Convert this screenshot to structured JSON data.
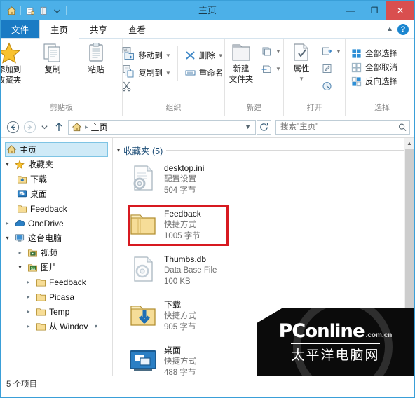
{
  "window": {
    "title": "主页",
    "quick_access": [
      "home-icon",
      "new-folder-icon",
      "properties-icon",
      "customize-dropdown"
    ],
    "minimize_label": "—",
    "maximize_label": "❐",
    "close_label": "✕"
  },
  "ribbon": {
    "tabs": [
      {
        "label": "文件",
        "type": "file"
      },
      {
        "label": "主页",
        "type": "active"
      },
      {
        "label": "共享",
        "type": "normal"
      },
      {
        "label": "查看",
        "type": "normal"
      }
    ],
    "collapse_icon": "chevron-up-icon",
    "help_label": "?",
    "groups": [
      {
        "name": "剪贴板",
        "big": [
          {
            "label": "添加到\n收藏夹",
            "label_line1": "添加到",
            "label_line2": "收藏夹",
            "icon": "star-icon"
          },
          {
            "label": "复制",
            "icon": "copy-icon"
          },
          {
            "label": "粘贴",
            "icon": "paste-icon"
          }
        ],
        "small": [
          {
            "label": "",
            "icon": "copy-path-icon"
          },
          {
            "label": "",
            "icon": "paste-shortcut-icon"
          },
          {
            "label": "",
            "icon": "cut-icon"
          }
        ]
      },
      {
        "name": "组织",
        "items": [
          {
            "label": "移动到",
            "icon": "move-to-icon",
            "dropdown": true
          },
          {
            "label": "复制到",
            "icon": "copy-to-icon",
            "dropdown": true
          },
          {
            "label": "删除",
            "icon": "delete-icon",
            "dropdown": true
          },
          {
            "label": "重命名",
            "icon": "rename-icon",
            "dropdown": false
          }
        ]
      },
      {
        "name": "新建",
        "big": [
          {
            "label_line1": "新建",
            "label_line2": "文件夹",
            "icon": "new-folder-icon"
          }
        ],
        "small": [
          {
            "label": "",
            "icon": "new-item-icon",
            "dropdown": true
          },
          {
            "label": "",
            "icon": "easy-access-icon",
            "dropdown": true
          }
        ]
      },
      {
        "name": "打开",
        "big": [
          {
            "label_line1": "属性",
            "label_line2": "",
            "icon": "properties-icon",
            "dropdown": true
          }
        ],
        "small": [
          {
            "label": "",
            "icon": "open-with-icon",
            "dropdown": true
          },
          {
            "label": "",
            "icon": "edit-icon"
          },
          {
            "label": "",
            "icon": "history-icon"
          }
        ]
      },
      {
        "name": "选择",
        "items": [
          {
            "label": "全部选择",
            "icon": "select-all-icon"
          },
          {
            "label": "全部取消",
            "icon": "select-none-icon"
          },
          {
            "label": "反向选择",
            "icon": "invert-selection-icon"
          }
        ]
      }
    ]
  },
  "addressbar": {
    "back_icon": "back-arrow-icon",
    "forward_icon": "forward-arrow-icon",
    "recent_icon": "chevron-down-icon",
    "up_icon": "up-arrow-icon",
    "breadcrumb_icon": "home-icon",
    "breadcrumb": "主页",
    "breadcrumb_separator": "▸",
    "path_dropdown_icon": "chevron-down-icon",
    "refresh_icon": "refresh-icon",
    "search_placeholder": "搜索\"主页\"",
    "search_value": "",
    "search_icon": "search-icon"
  },
  "sidebar": {
    "items": [
      {
        "label": "主页",
        "icon": "home-icon",
        "indent": 1,
        "twisty": "none",
        "selected": true
      },
      {
        "label": "收藏夹",
        "icon": "star-icon",
        "indent": 1,
        "twisty": "open",
        "selected": false
      },
      {
        "label": "下载",
        "icon": "downloads-folder-icon",
        "indent": 2,
        "twisty": "none",
        "selected": false
      },
      {
        "label": "桌面",
        "icon": "desktop-icon",
        "indent": 2,
        "twisty": "none",
        "selected": false
      },
      {
        "label": "Feedback",
        "icon": "folder-icon",
        "indent": 2,
        "twisty": "none",
        "selected": false
      },
      {
        "label": "OneDrive",
        "icon": "onedrive-icon",
        "indent": 1,
        "twisty": "closed",
        "selected": false
      },
      {
        "label": "这台电脑",
        "icon": "this-pc-icon",
        "indent": 1,
        "twisty": "open",
        "selected": false
      },
      {
        "label": "视频",
        "icon": "videos-folder-icon",
        "indent": 2,
        "twisty": "closed",
        "selected": false
      },
      {
        "label": "图片",
        "icon": "pictures-folder-icon",
        "indent": 2,
        "twisty": "open",
        "selected": false
      },
      {
        "label": "Feedback",
        "icon": "folder-icon",
        "indent": 3,
        "twisty": "closed",
        "selected": false
      },
      {
        "label": "Picasa",
        "icon": "folder-icon",
        "indent": 3,
        "twisty": "closed",
        "selected": false
      },
      {
        "label": "Temp",
        "icon": "folder-icon",
        "indent": 3,
        "twisty": "closed",
        "selected": false
      },
      {
        "label": "从 Windov",
        "icon": "folder-icon",
        "indent": 3,
        "twisty": "closed",
        "selected": false
      }
    ],
    "scroll_up_icon": "chevron-up-icon",
    "scroll_down_icon": "chevron-down-icon"
  },
  "filelist": {
    "group_header": "收藏夹 (5)",
    "group_twisty": "open",
    "items": [
      {
        "name": "desktop.ini",
        "type": "配置设置",
        "size": "504 字节",
        "icon": "ini-file-icon",
        "highlighted": false
      },
      {
        "name": "Feedback",
        "type": "快捷方式",
        "size": "1005 字节",
        "icon": "folder-shortcut-icon",
        "highlighted": true
      },
      {
        "name": "Thumbs.db",
        "type": "Data Base File",
        "size": "100 KB",
        "icon": "db-file-icon",
        "highlighted": false
      },
      {
        "name": "下载",
        "type": "快捷方式",
        "size": "905 字节",
        "icon": "downloads-folder-icon",
        "highlighted": false
      },
      {
        "name": "桌面",
        "type": "快捷方式",
        "size": "488 字节",
        "icon": "desktop-icon",
        "highlighted": false
      }
    ],
    "scroll_up_icon": "chevron-up-icon"
  },
  "statusbar": {
    "text": "5 个项目"
  },
  "watermark": {
    "brand_pc": "PC",
    "brand_online": "online",
    "domain": ".com.cn",
    "chinese": "太平洋电脑网"
  },
  "colors": {
    "titlebar": "#4cb0e8",
    "file_tab": "#1a7bc4",
    "close_button": "#d94f4f",
    "selection": "#cfeaf7",
    "annotation_red": "#d71920",
    "group_header_text": "#1f4f78"
  }
}
